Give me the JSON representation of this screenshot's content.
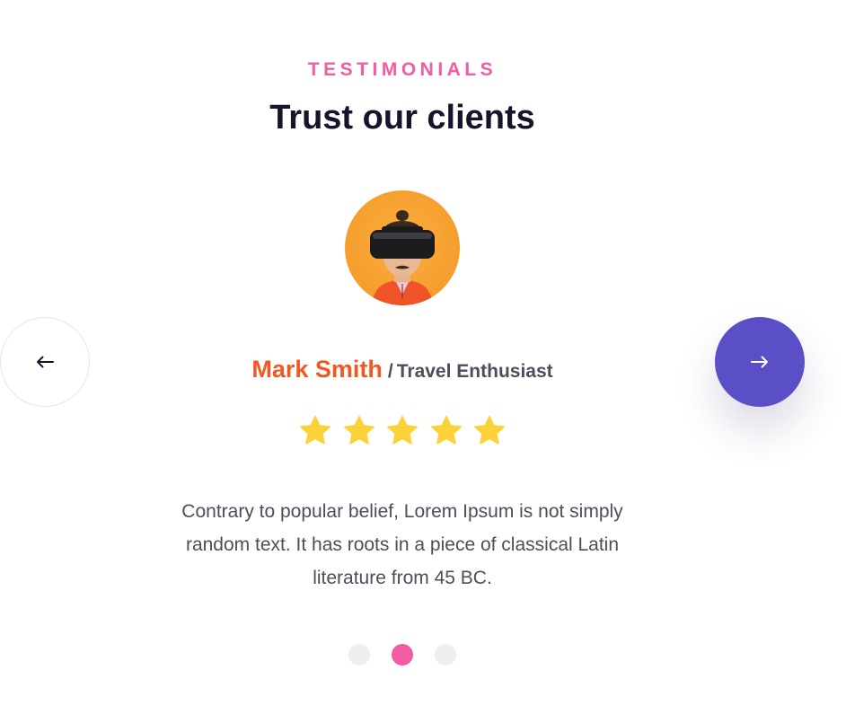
{
  "section": {
    "eyebrow": "TESTIMONIALS",
    "title": "Trust our clients"
  },
  "testimonial": {
    "name": "Mark Smith",
    "separator": "/",
    "role": "Travel Enthusiast",
    "rating": 5,
    "rating_max": 5,
    "quote": "Contrary to popular belief, Lorem Ipsum is not simply random text. It has roots in a piece of classical Latin literature from 45 BC.",
    "avatar_icon": "person-vr-headset-photo"
  },
  "navigation": {
    "prev_icon": "arrow-left-icon",
    "next_icon": "arrow-right-icon"
  },
  "pagination": {
    "total": 3,
    "active_index": 1
  },
  "colors": {
    "eyebrow": "#f25ca2",
    "title": "#14142b",
    "name": "#f05a22",
    "star": "#fdd13a",
    "next_button": "#5b4fc7",
    "active_dot": "#f25ca2",
    "inactive_dot": "#efeff1"
  }
}
